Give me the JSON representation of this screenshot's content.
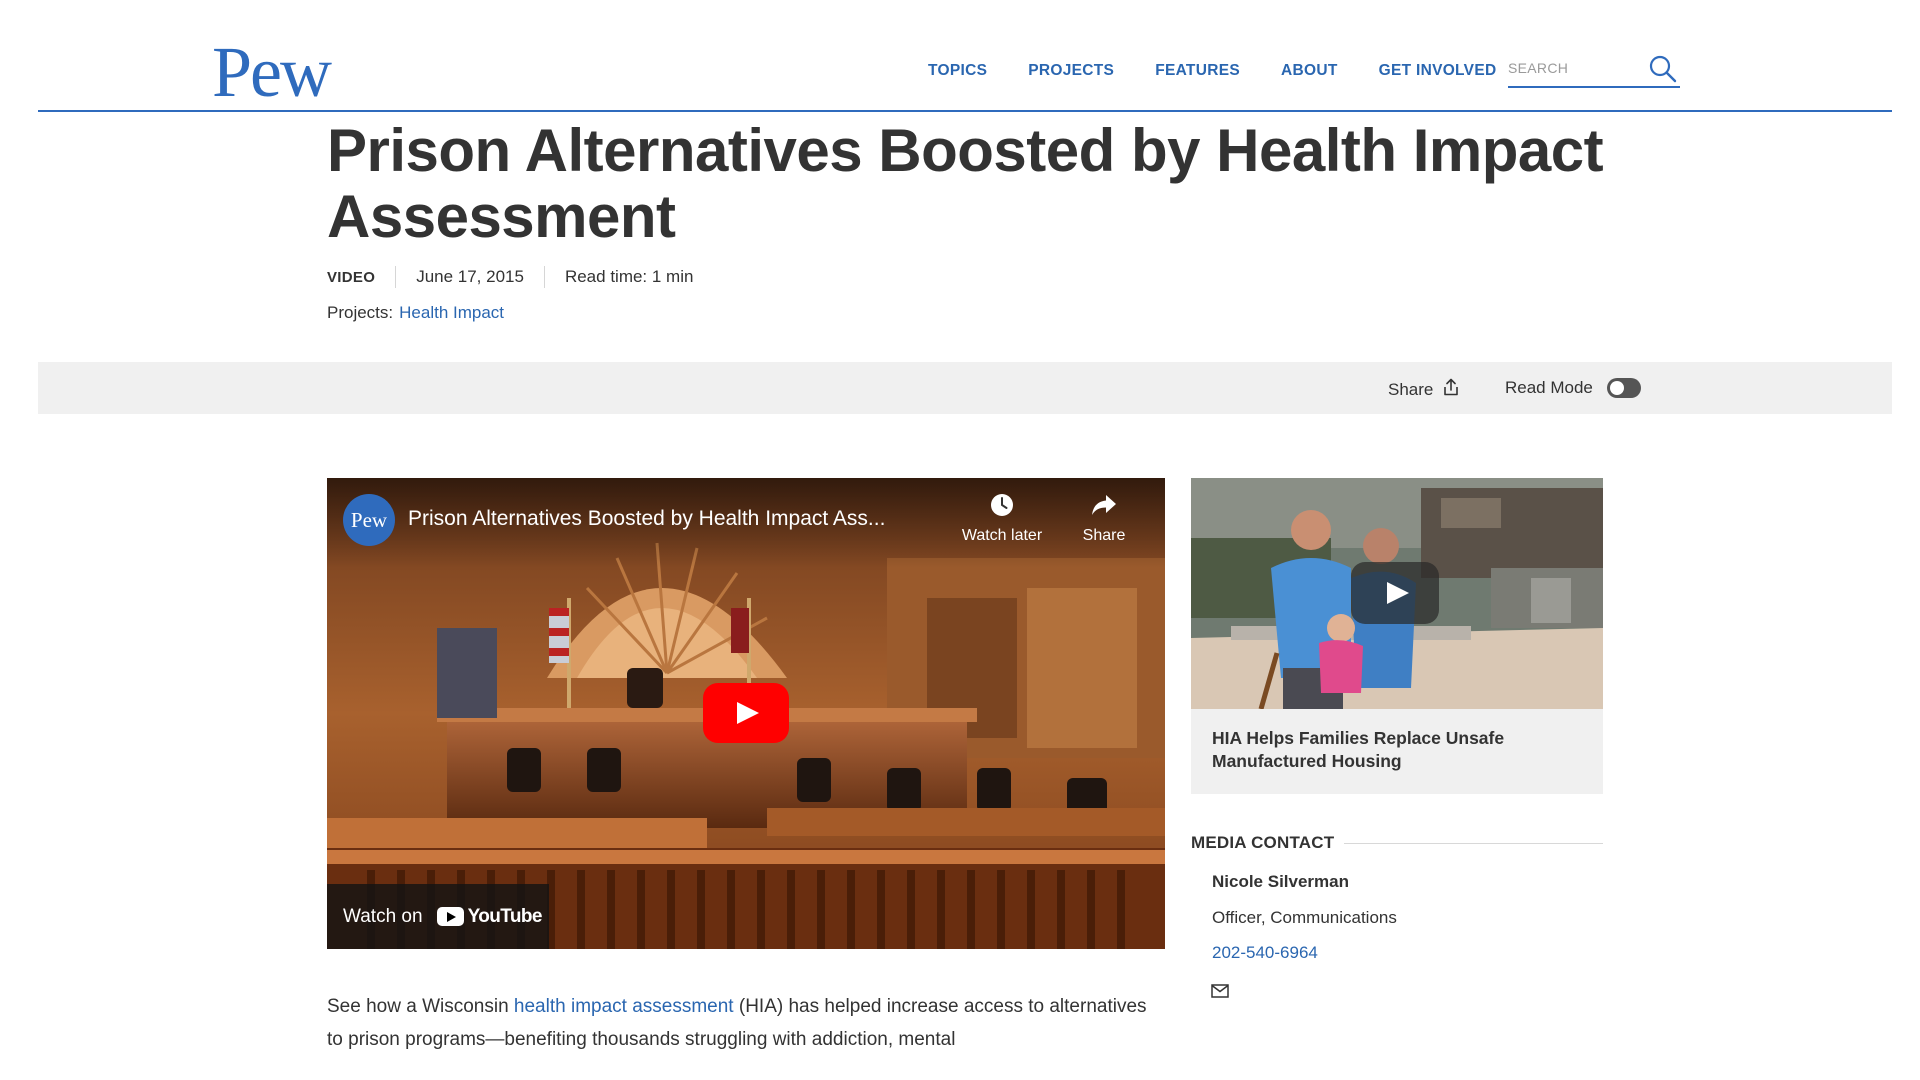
{
  "header": {
    "logo": "Pew",
    "nav": [
      "TOPICS",
      "PROJECTS",
      "FEATURES",
      "ABOUT",
      "GET INVOLVED"
    ],
    "search_placeholder": "SEARCH"
  },
  "article": {
    "title": "Prison Alternatives Boosted by Health Impact Assessment",
    "type": "VIDEO",
    "date": "June 17, 2015",
    "read_time": "Read time: 1 min",
    "projects_label": "Projects:",
    "project_link": "Health Impact",
    "body_prefix": "See how a Wisconsin ",
    "body_link": "health impact assessment",
    "body_suffix": " (HIA) has helped increase access to alternatives to prison programs—benefiting thousands struggling with addiction, mental"
  },
  "toolbar": {
    "share_label": "Share",
    "read_mode_label": "Read Mode",
    "read_mode_on": false
  },
  "video": {
    "channel": "Pew",
    "title": "Prison Alternatives Boosted by Health Impact Ass...",
    "watch_later": "Watch later",
    "share": "Share",
    "watch_on": "Watch on",
    "youtube": "YouTube"
  },
  "related": {
    "title": "HIA Helps Families Replace Unsafe Manufactured Housing"
  },
  "media_contact": {
    "heading": "MEDIA CONTACT",
    "name": "Nicole Silverman",
    "role": "Officer, Communications",
    "phone": "202-540-6964"
  },
  "colors": {
    "brand_blue": "#2f6bbd",
    "link_blue": "#2a66b0",
    "youtube_red": "#ff0000",
    "toolbar_gray": "#f0f0f0"
  },
  "icons": {
    "search": "search-icon",
    "share": "share-icon",
    "clock": "clock-icon",
    "mail": "mail-icon"
  }
}
